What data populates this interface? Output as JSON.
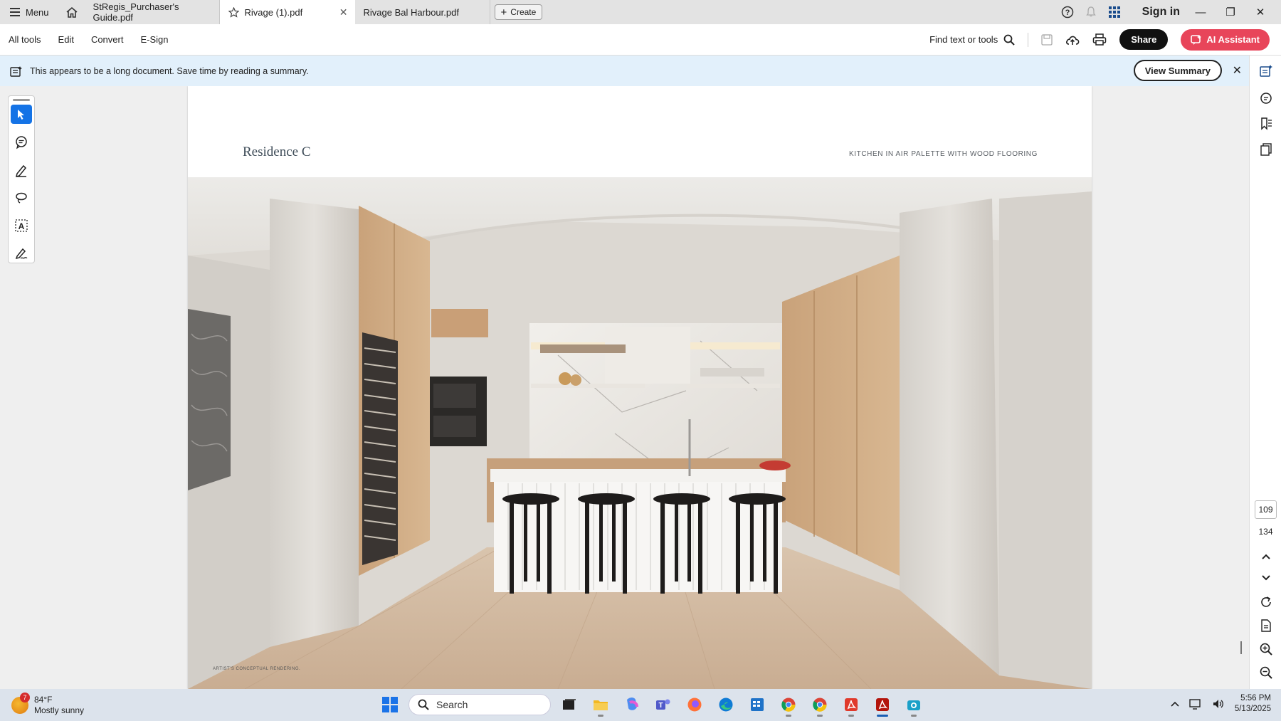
{
  "tabbar": {
    "menu_label": "Menu",
    "tabs": [
      {
        "label": "StRegis_Purchaser's Guide.pdf"
      },
      {
        "label": "Rivage (1).pdf"
      },
      {
        "label": "Rivage Bal Harbour.pdf"
      }
    ],
    "create_label": "Create",
    "signin_label": "Sign in"
  },
  "toolbar": {
    "items": [
      "All tools",
      "Edit",
      "Convert",
      "E-Sign"
    ],
    "find_label": "Find text or tools",
    "share_label": "Share",
    "ai_label": "AI Assistant"
  },
  "banner": {
    "message": "This appears to be a long document. Save time by reading a summary.",
    "button_label": "View Summary"
  },
  "document": {
    "title": "Residence C",
    "caption": "KITCHEN IN AIR PALETTE WITH WOOD FLOORING",
    "render_caption": "ARTIST'S CONCEPTUAL RENDERING."
  },
  "pagenav": {
    "current_page": "109",
    "total_pages": "134"
  },
  "taskbar": {
    "temp": "84°F",
    "condition": "Mostly sunny",
    "weather_badge": "7",
    "search_placeholder": "Search",
    "time": "5:56 PM",
    "date": "5/13/2025"
  },
  "colors": {
    "accent": "#1473e6",
    "ai_button": "#e8455a",
    "banner": "#e2f0fb"
  }
}
